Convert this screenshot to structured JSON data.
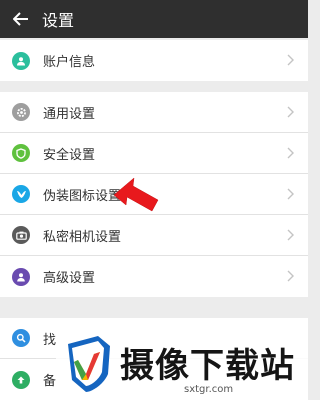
{
  "header": {
    "title": "设置"
  },
  "groups": [
    {
      "items": [
        {
          "label": "账户信息",
          "icon": "account-icon",
          "color": "#2bbf9d"
        }
      ]
    },
    {
      "items": [
        {
          "label": "通用设置",
          "icon": "gear-icon",
          "color": "#9e9e9e"
        },
        {
          "label": "安全设置",
          "icon": "shield-icon",
          "color": "#5fc13e"
        },
        {
          "label": "伪装图标设置",
          "icon": "disguise-icon",
          "color": "#1aa7e6"
        },
        {
          "label": "私密相机设置",
          "icon": "camera-icon",
          "color": "#5a5a5a"
        },
        {
          "label": "高级设置",
          "icon": "advanced-icon",
          "color": "#6a4bb0"
        }
      ]
    },
    {
      "items": [
        {
          "label": "找",
          "icon": "search-icon",
          "color": "#2f8fe0"
        },
        {
          "label": "备",
          "icon": "backup-icon",
          "color": "#2eae63"
        }
      ]
    }
  ],
  "watermark": {
    "title": "摄像下载站",
    "url": "sxtgr.com"
  },
  "colors": {
    "header_bg": "#2f2f2f",
    "page_bg": "#ececec",
    "arrow": "#e8191d"
  }
}
